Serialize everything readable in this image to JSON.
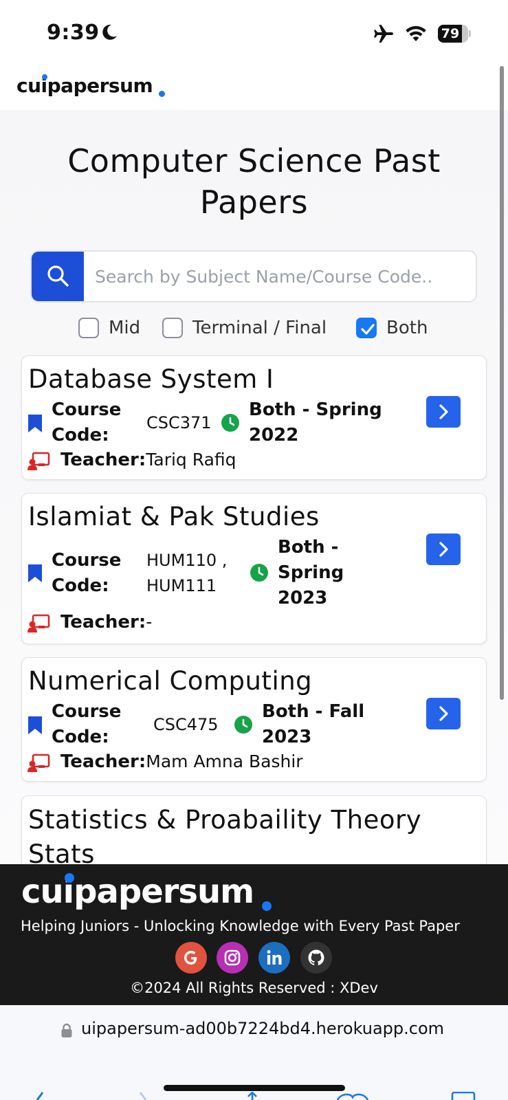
{
  "status_bar": {
    "time": "9:39",
    "battery_level": "79",
    "battery_fraction": 0.79,
    "icons": [
      "moon-icon",
      "airplane-icon",
      "wifi-icon",
      "battery-icon"
    ]
  },
  "header": {
    "logo_text": "cuipapersum",
    "accent_color": "#1877f2"
  },
  "page": {
    "title": "Computer Science Past Papers"
  },
  "search": {
    "placeholder": "Search by Subject Name/Course Code..",
    "value": ""
  },
  "filters": [
    {
      "label": "Mid",
      "checked": false
    },
    {
      "label": "Terminal / Final",
      "checked": false
    },
    {
      "label": "Both",
      "checked": true
    }
  ],
  "cards": [
    {
      "title": "Database System I",
      "course_code_label": "Course Code:",
      "course_code": "CSC371",
      "term": "Both - Spring 2022",
      "teacher_label": "Teacher:",
      "teacher": "Tariq Rafiq"
    },
    {
      "title": "Islamiat & Pak Studies",
      "course_code_label": "Course Code:",
      "course_code": "HUM110 , HUM111",
      "term": "Both - Spring 2023",
      "teacher_label": "Teacher:",
      "teacher": "-"
    },
    {
      "title": "Numerical Computing",
      "course_code_label": "Course Code:",
      "course_code": "CSC475",
      "term": "Both - Fall 2023",
      "teacher_label": "Teacher:",
      "teacher": "Mam Amna Bashir"
    },
    {
      "title": "Statistics & Proabaility Theory Stats"
    }
  ],
  "footer": {
    "logo_text": "cuipapersum",
    "tagline": "Helping Juniors - Unlocking Knowledge with Every Past Paper",
    "social": [
      {
        "name": "google",
        "color": "#e0533f"
      },
      {
        "name": "instagram",
        "color": "#b62fb5"
      },
      {
        "name": "linkedin",
        "color": "#1c6fbf"
      },
      {
        "name": "github",
        "color": "#333333"
      }
    ],
    "copyright": "©2024 All Rights Reserved : XDev"
  },
  "browser": {
    "url": "uipapersum-ad00b7224bd4.herokuapp.com"
  }
}
